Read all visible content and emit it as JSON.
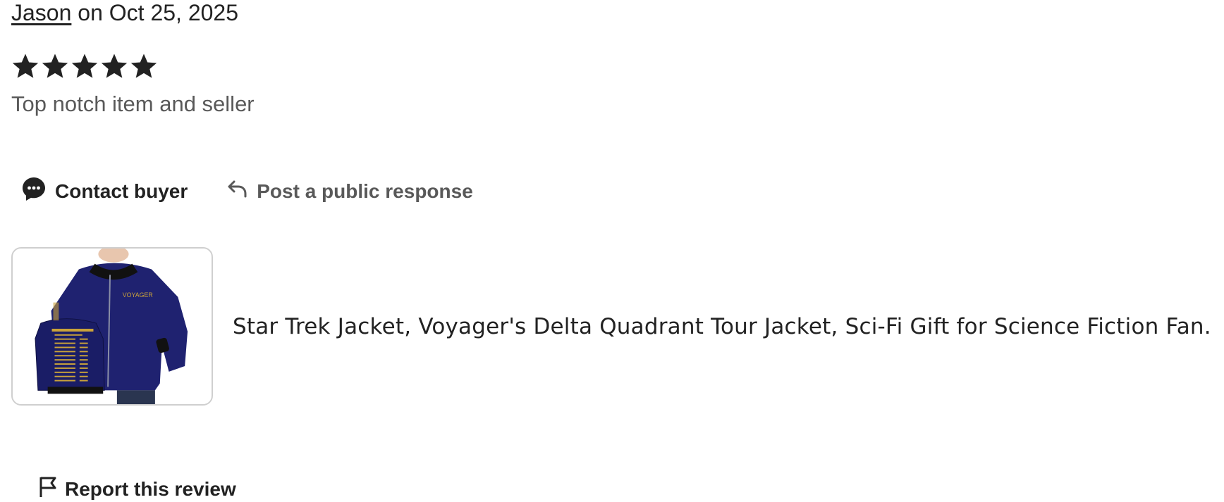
{
  "review": {
    "author": "Jason",
    "date_text": "on Oct 25, 2025",
    "rating": 5,
    "max_rating": 5,
    "text": "Top notch item and seller"
  },
  "actions": {
    "contact_label": "Contact buyer",
    "respond_label": "Post a public response"
  },
  "listing": {
    "title": "Star Trek Jacket, Voyager's Delta Quadrant Tour Jacket, Sci-Fi Gift for Science Fiction Fan.",
    "image_icon": "jacket-product-image",
    "jacket_text": "VOYAGER"
  },
  "footer": {
    "report_label": "Report this review"
  },
  "colors": {
    "text": "#222222",
    "muted": "#595959",
    "jacket": "#1f2270",
    "accent": "#c9a23a"
  }
}
